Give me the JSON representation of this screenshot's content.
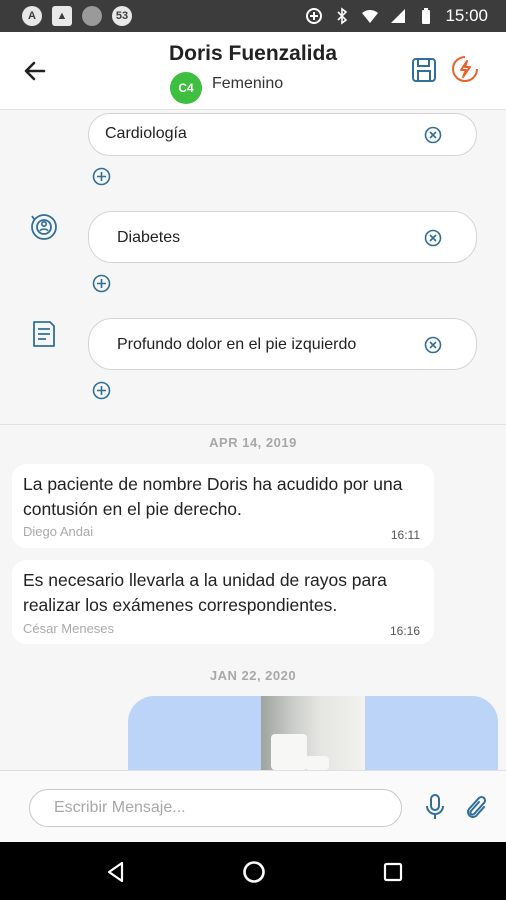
{
  "status_bar": {
    "time": "15:00",
    "left_icons": [
      "app-a-icon",
      "image-icon",
      "dot-icon",
      "notification-count-icon"
    ],
    "notification_count": "53",
    "right_icons": [
      "data-saver-icon",
      "bluetooth-icon",
      "wifi-icon",
      "signal-icon",
      "battery-icon"
    ]
  },
  "header": {
    "title": "Doris Fuenzalida",
    "badge": "C4",
    "gender": "Femenino",
    "colors": {
      "badge": "#3fbf3f",
      "accent_blue": "#2f6f9a",
      "accent_orange": "#e8632b"
    }
  },
  "fields": [
    {
      "value": "Cardiología",
      "icon": ""
    },
    {
      "value": "Diabetes",
      "icon": "allergy-icon"
    },
    {
      "value": "Profundo dolor en el pie izquierdo",
      "icon": "notes-icon"
    }
  ],
  "chat": {
    "groups": [
      {
        "date": "APR 14, 2019",
        "messages": [
          {
            "text": "La paciente de nombre Doris ha acudido por una contusión en el pie derecho.",
            "author": "Diego Andai",
            "time": "16:11"
          },
          {
            "text": "Es necesario llevarla a la unidad de rayos para realizar los exámenes correspondientes.",
            "author": "César Meneses",
            "time": "16:16"
          }
        ]
      },
      {
        "date": "JAN 22, 2020",
        "messages": []
      }
    ]
  },
  "composer": {
    "placeholder": "Escribir Mensaje..."
  }
}
